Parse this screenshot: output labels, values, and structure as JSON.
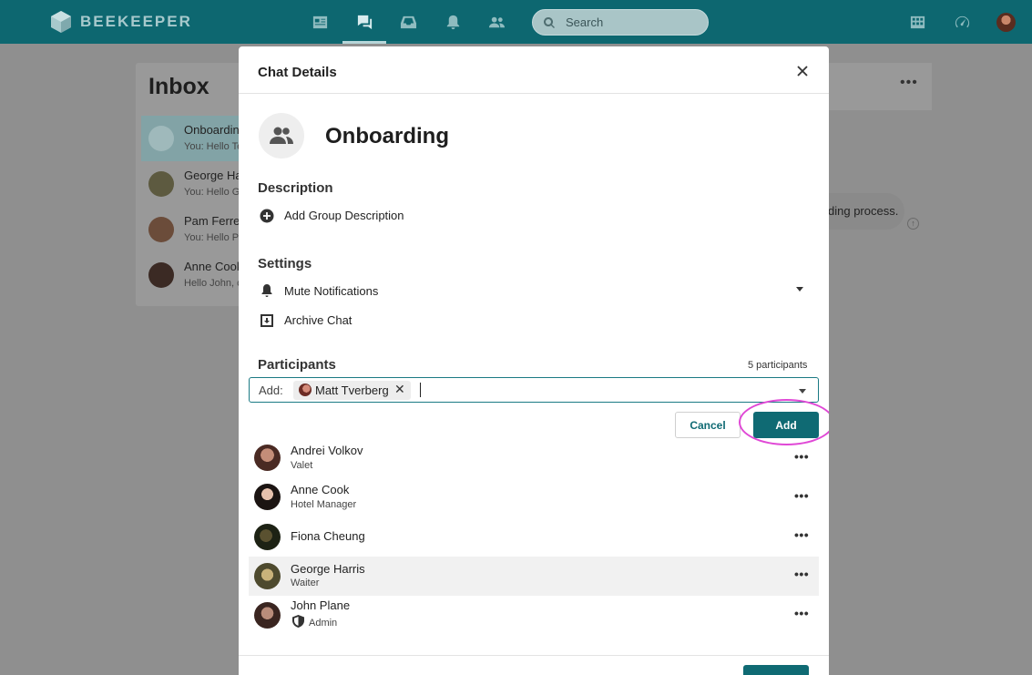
{
  "brand": {
    "name": "BEEKEEPER"
  },
  "topnav": {
    "items": [
      {
        "icon": "news-feed-icon"
      },
      {
        "icon": "chat-icon",
        "active": true
      },
      {
        "icon": "inbox-tray-icon"
      },
      {
        "icon": "bell-icon"
      },
      {
        "icon": "people-icon"
      }
    ],
    "search_placeholder": "Search",
    "right_icons": [
      "apps-grid-icon",
      "speedometer-icon",
      "user-avatar"
    ]
  },
  "inbox": {
    "title": "Inbox",
    "items": [
      {
        "name": "Onboardin",
        "preview": "You: Hello Te",
        "selected": true
      },
      {
        "name": "George Ha",
        "preview": "You: Hello Ge"
      },
      {
        "name": "Pam Ferrer",
        "preview": "You: Hello Pa"
      },
      {
        "name": "Anne Cook",
        "preview": "Hello John, c"
      }
    ]
  },
  "conversation": {
    "message_fragment": "ding process."
  },
  "modal": {
    "title": "Chat Details",
    "group_name": "Onboarding",
    "description": {
      "title": "Description",
      "add_label": "Add Group Description"
    },
    "settings": {
      "title": "Settings",
      "mute_label": "Mute Notifications",
      "archive_label": "Archive Chat"
    },
    "participants": {
      "title": "Participants",
      "count_label": "5 participants",
      "add_field": {
        "label": "Add:",
        "chip_name": "Matt Tverberg"
      },
      "cancel_label": "Cancel",
      "add_label": "Add",
      "list": [
        {
          "name": "Andrei Volkov",
          "role": "Valet"
        },
        {
          "name": "Anne Cook",
          "role": "Hotel Manager"
        },
        {
          "name": "Fiona Cheung",
          "role": ""
        },
        {
          "name": "George Harris",
          "role": "Waiter",
          "hovered": true
        },
        {
          "name": "John Plane",
          "role": "Admin",
          "admin": true
        }
      ]
    },
    "close_label": "Close"
  }
}
